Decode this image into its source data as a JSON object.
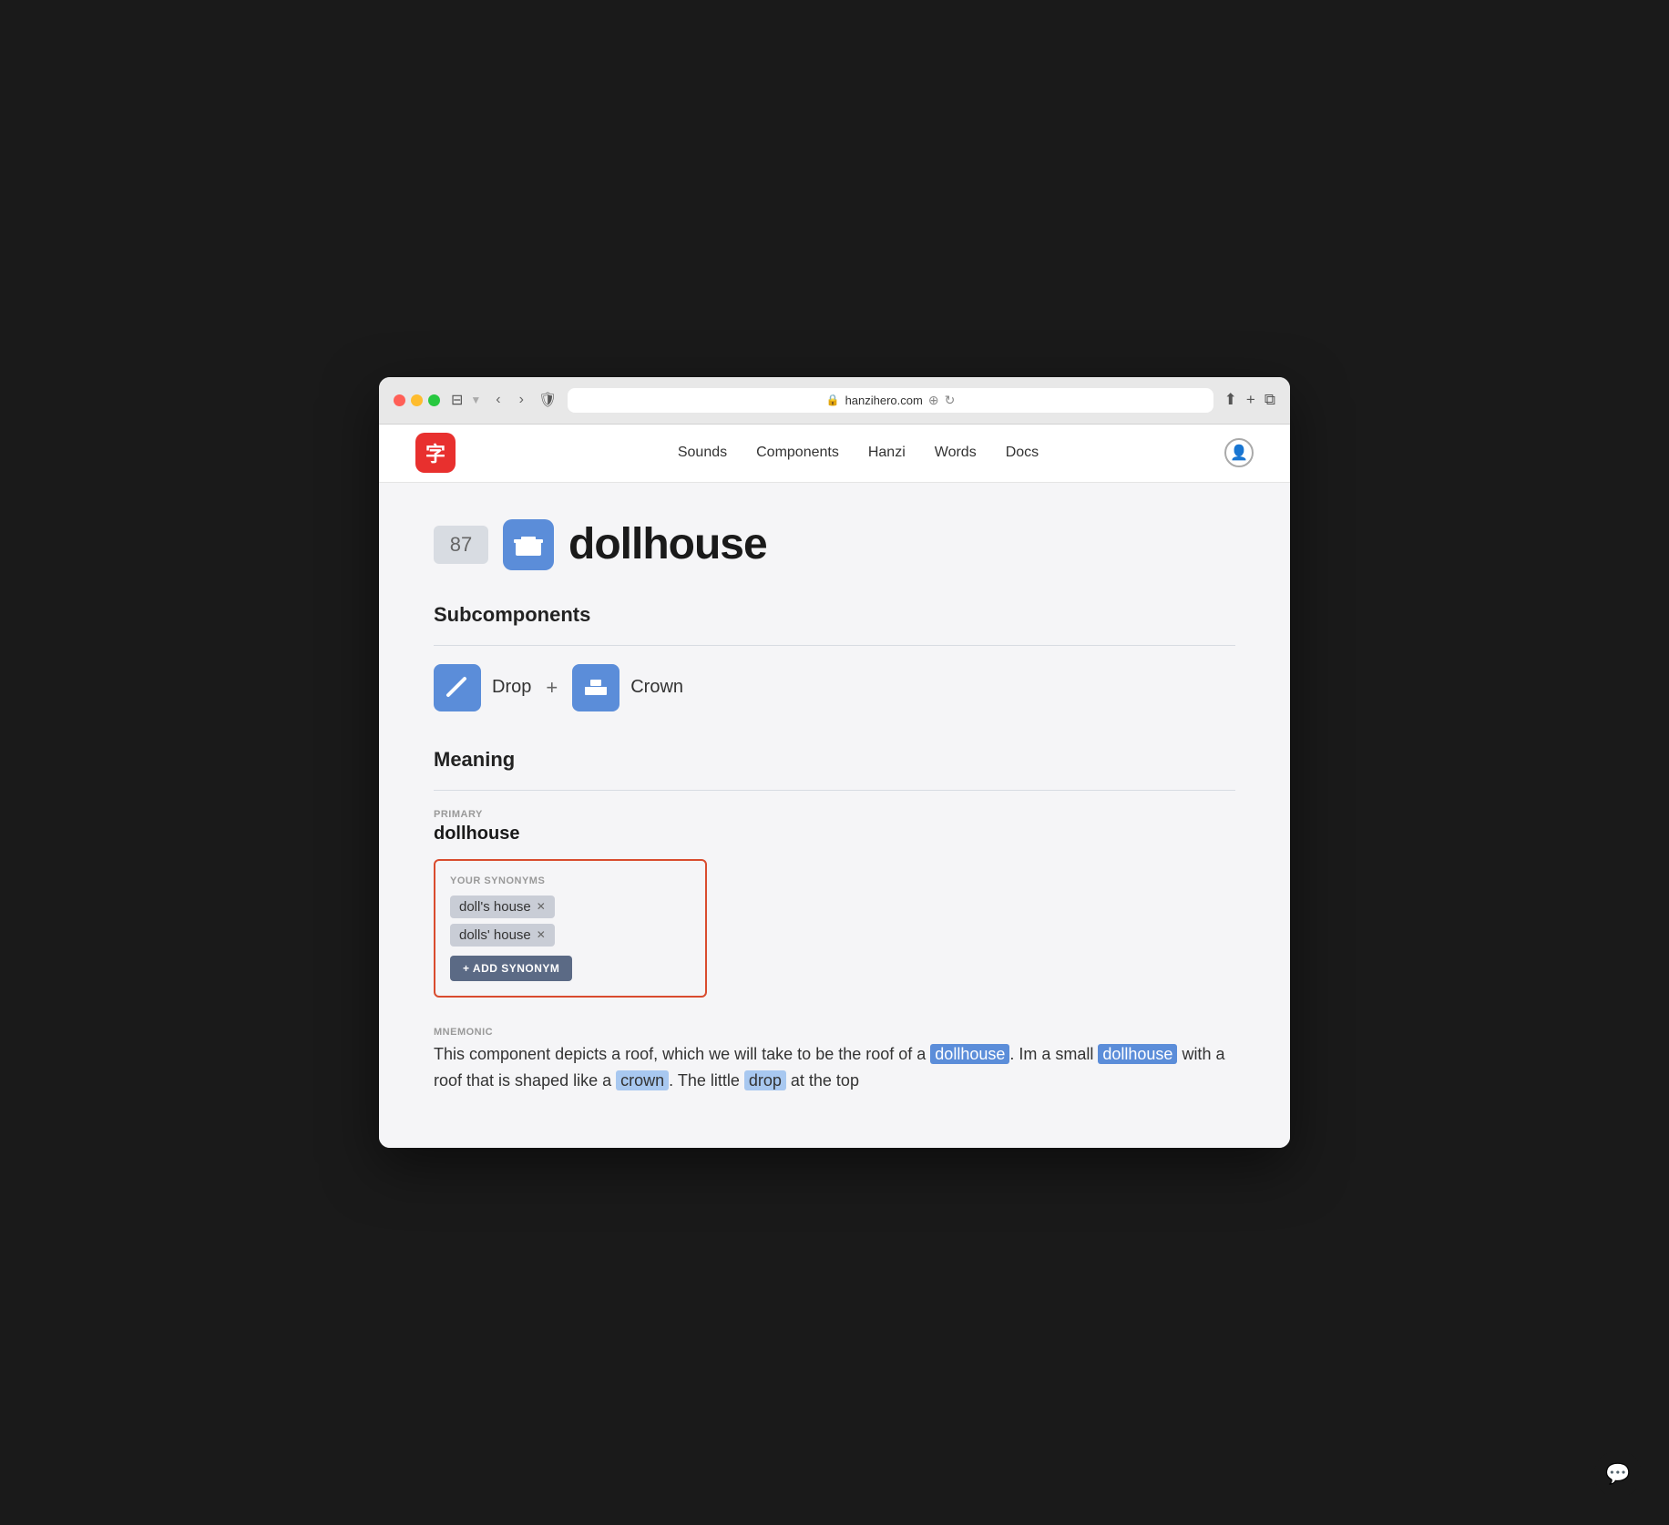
{
  "browser": {
    "url": "hanzihero.com",
    "traffic_lights": [
      "red",
      "yellow",
      "green"
    ]
  },
  "nav": {
    "logo_char": "字",
    "links": [
      "Sounds",
      "Components",
      "Hanzi",
      "Words",
      "Docs"
    ]
  },
  "component": {
    "number": "87",
    "title": "dollhouse",
    "subcomponents_heading": "Subcomponents",
    "subcomponents": [
      {
        "label": "Drop"
      },
      {
        "label": "Crown"
      }
    ],
    "meaning_heading": "Meaning",
    "primary_label": "PRIMARY",
    "primary_value": "dollhouse",
    "synonyms_label": "YOUR SYNONYMS",
    "synonyms": [
      "doll's house",
      "dolls' house"
    ],
    "add_synonym_btn": "+ ADD SYNONYM",
    "mnemonic_label": "MNEMONIC",
    "mnemonic_text_parts": [
      "This component depicts a roof, which we will take to be the roof of a ",
      "dollhouse",
      ". Im",
      "a small ",
      "dollhouse",
      " with a roof that is shaped like a ",
      "crown",
      ". The little ",
      "drop",
      " at the top"
    ]
  }
}
